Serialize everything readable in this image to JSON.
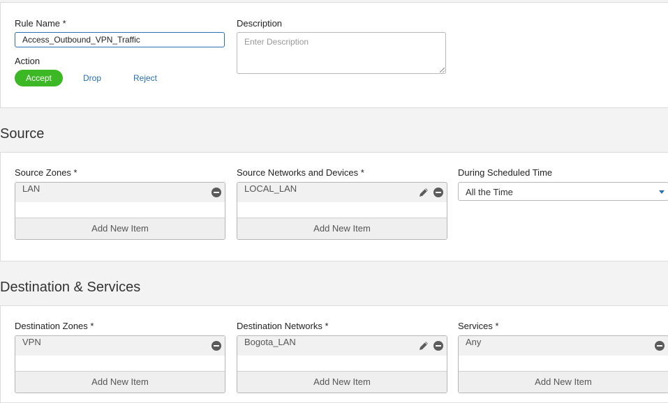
{
  "rule": {
    "name_label": "Rule Name *",
    "name_value": "Access_Outbound_VPN_Traffic",
    "description_label": "Description",
    "description_placeholder": "Enter Description",
    "action_label": "Action",
    "actions": [
      "Accept",
      "Drop",
      "Reject"
    ],
    "selected_action": "Accept"
  },
  "source": {
    "title": "Source",
    "zones_label": "Source Zones *",
    "zones_items": [
      "LAN"
    ],
    "networks_label": "Source Networks and Devices *",
    "networks_items": [
      "LOCAL_LAN"
    ],
    "schedule_label": "During Scheduled Time",
    "schedule_value": "All the Time"
  },
  "destination": {
    "title": "Destination & Services",
    "zones_label": "Destination Zones *",
    "zones_items": [
      "VPN"
    ],
    "networks_label": "Destination Networks *",
    "networks_items": [
      "Bogota_LAN"
    ],
    "services_label": "Services *",
    "services_items": [
      "Any"
    ]
  },
  "common": {
    "add_new_item": "Add New Item"
  },
  "colors": {
    "accent": "#2a6fb0",
    "accept_green": "#3cb824"
  },
  "icons": {
    "remove": "remove-circle-icon",
    "edit": "pencil-icon",
    "dropdown": "caret-down-icon"
  }
}
